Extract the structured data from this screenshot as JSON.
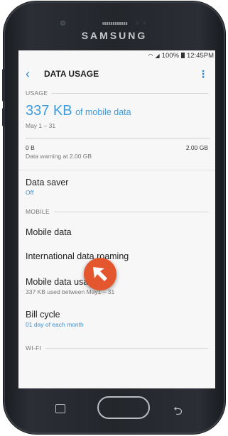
{
  "device": {
    "brand": "SAMSUNG"
  },
  "status": {
    "icons": [
      "wifi-icon",
      "signal-icon",
      "battery-icon"
    ],
    "battery": "100%",
    "time": "12:45PM"
  },
  "appbar": {
    "back_icon": "chevron-left-icon",
    "title": "DATA USAGE",
    "more_icon": "more-vert-icon"
  },
  "usage": {
    "section": "USAGE",
    "amount": "337 KB",
    "amount_suffix": "of mobile data",
    "range": "May 1 – 31",
    "scale_min": "0 B",
    "scale_max": "2.00 GB",
    "warning": "Data warning at 2.00 GB"
  },
  "data_saver": {
    "label": "Data saver",
    "value": "Off"
  },
  "mobile": {
    "section": "MOBILE",
    "mobile_data": "Mobile data",
    "roaming": "International data roaming",
    "usage_label": "Mobile data usage",
    "usage_sub": "337 KB used between May1 – 31",
    "bill_cycle": "Bill cycle",
    "bill_cycle_sub": "01 day of each month"
  },
  "wifi": {
    "section": "WI-FI"
  },
  "hardware_keys": [
    "recent-apps-icon",
    "home-button",
    "back-icon"
  ],
  "colors": {
    "accent": "#3a8fd6",
    "pointer": "#e4572e"
  }
}
